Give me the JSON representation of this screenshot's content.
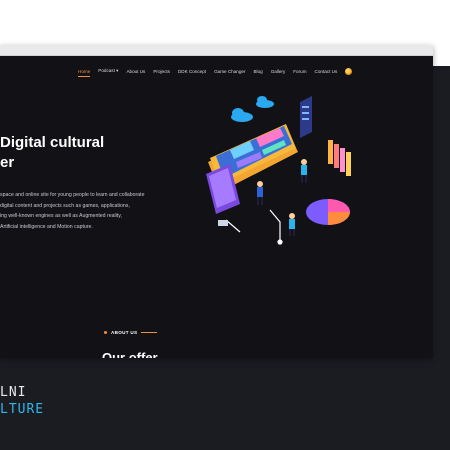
{
  "nav": {
    "items": [
      {
        "label": "Home",
        "active": true
      },
      {
        "label": "Podcast ▾"
      },
      {
        "label": "About Us"
      },
      {
        "label": "Projects"
      },
      {
        "label": "DDK Concept"
      },
      {
        "label": "Game Changer"
      },
      {
        "label": "Blog"
      },
      {
        "label": "Gallery"
      },
      {
        "label": "Forum"
      },
      {
        "label": "Contact Us"
      }
    ],
    "language_icon": "flag-icon"
  },
  "hero": {
    "title_line1": "Digital cultural",
    "title_line2": "er",
    "text_lines": [
      "space and online site for young people to learn and collaborate",
      "digital content and projects such as games, applications,",
      "ing well-known engines as well as Augmented reality,",
      "Artificial intelligence and Motion capture."
    ]
  },
  "about": {
    "label": "ABOUT US",
    "heading": "Our offer"
  },
  "logo": {
    "line1": "LNI",
    "line2": "LTURE"
  },
  "colors": {
    "accent": "#f0913a",
    "background": "#121216",
    "logo_blue": "#2fb7e8"
  }
}
